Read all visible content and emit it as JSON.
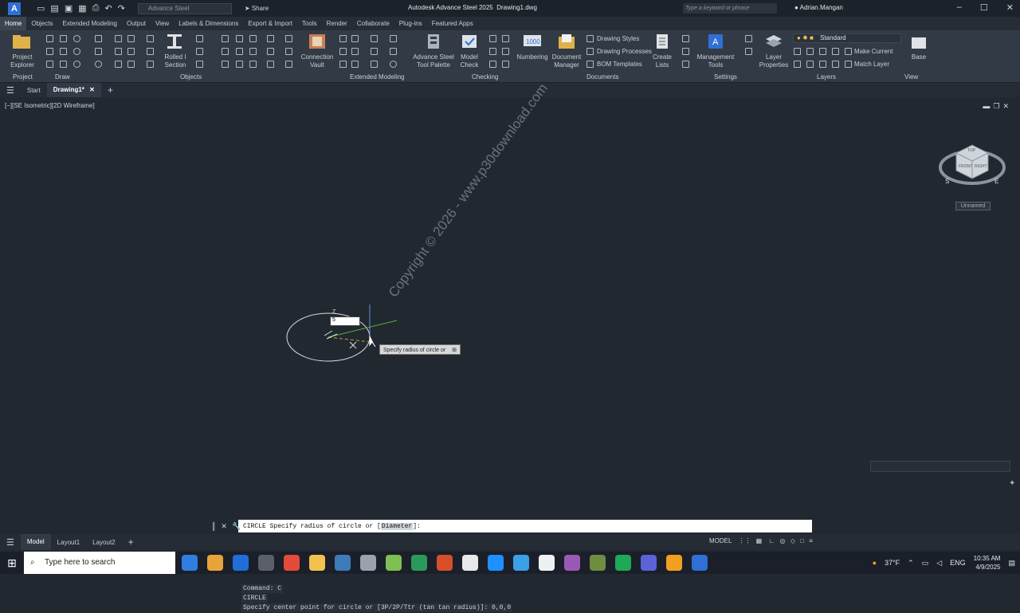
{
  "titlebar": {
    "app_title": "Autodesk Advance Steel 2025",
    "file_name": "Drawing1.dwg",
    "workspace": "Advance Steel",
    "share_label": "Share",
    "search_placeholder": "Type a keyword or phrase",
    "user_name": "Adrian.Mangan"
  },
  "ribbon_tabs": [
    "Home",
    "Objects",
    "Extended Modeling",
    "Output",
    "View",
    "Labels & Dimensions",
    "Export & Import",
    "Tools",
    "Render",
    "Collaborate",
    "Plug-ins",
    "Featured Apps"
  ],
  "ribbon": {
    "project_explorer": "Project Explorer",
    "rolled_section": "Rolled I Section",
    "connection_vault": "Connection Vault",
    "tool_palette": "Advance Steel Tool Palette",
    "model_check": "Model Check",
    "numbering": "Numbering",
    "document_manager": "Document Manager",
    "drawing_styles": "Drawing Styles",
    "drawing_processes": "Drawing Processes",
    "bom_templates": "BOM Templates",
    "create_lists": "Create Lists",
    "management_tools": "Management Tools",
    "layer_properties": "Layer Properties",
    "layer_name": "Standard",
    "make_current": "Make Current",
    "match_layer": "Match Layer",
    "base": "Base",
    "panels": {
      "project": "Project",
      "draw": "Draw",
      "objects": "Objects",
      "extended_modeling": "Extended Modeling",
      "checking": "Checking",
      "documents": "Documents",
      "settings": "Settings",
      "layers": "Layers",
      "view": "View"
    }
  },
  "file_tabs": {
    "start": "Start",
    "drawing": "Drawing1*"
  },
  "viewport": {
    "label": "[−][SE Isometric][2D Wireframe]",
    "named_view": "Unnamed",
    "tooltip": "Specify radius of circle or",
    "dynamic_input": "5",
    "watermark": "Copyright © 2026 - www.p30download.com"
  },
  "command": {
    "history": [
      "Command: C",
      "CIRCLE",
      "Specify center point for circle or [3P/2P/Ttr (tan tan radius)]: 0,0,0"
    ],
    "prompt_prefix": "CIRCLE Specify radius of circle or [",
    "prompt_option": "Diameter",
    "prompt_suffix": "]:"
  },
  "layout_tabs": [
    "Model",
    "Layout1",
    "Layout2"
  ],
  "status": {
    "model_label": "MODEL"
  },
  "taskbar": {
    "search_placeholder": "Type here to search",
    "weather": "37°F",
    "language": "ENG",
    "time": "10:35 AM",
    "date": "4/9/2025",
    "icon_colors": [
      "#2f7fe0",
      "#e8a43a",
      "#1e6fd8",
      "#5a5f6a",
      "#e34b3a",
      "#f2c14e",
      "#3d7ab8",
      "#9aa2ad",
      "#7fbf52",
      "#2a9a5a",
      "#d64f2a",
      "#e8e8e8",
      "#1e90ff",
      "#3aa0e8",
      "#eef0f2",
      "#9b59b6",
      "#6c8e3e",
      "#1fa855",
      "#5b63d6",
      "#f0a020",
      "#2f6fd6"
    ]
  }
}
